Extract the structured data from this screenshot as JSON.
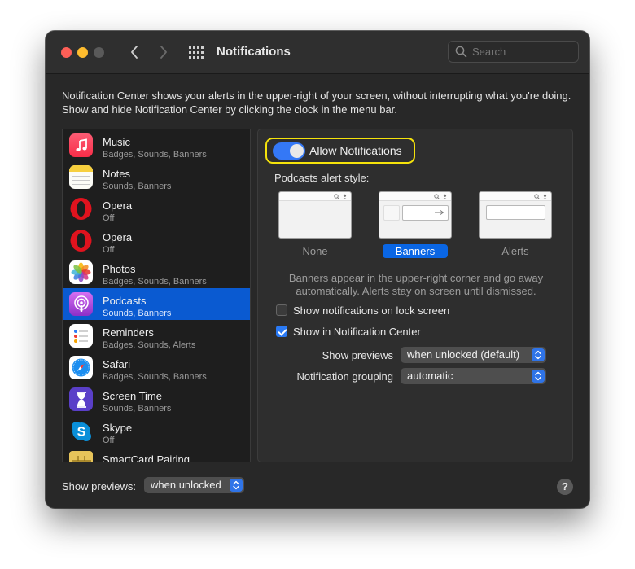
{
  "window": {
    "title": "Notifications"
  },
  "search": {
    "placeholder": "Search"
  },
  "description": "Notification Center shows your alerts in the upper-right of your screen, without interrupting what you're doing. Show and hide Notification Center by clicking the clock in the menu bar.",
  "apps": [
    {
      "name": "Music",
      "detail": "Badges, Sounds, Banners",
      "icon": "music-icon",
      "selected": false
    },
    {
      "name": "Notes",
      "detail": "Sounds, Banners",
      "icon": "notes-icon",
      "selected": false
    },
    {
      "name": "Opera",
      "detail": "Off",
      "icon": "opera-icon",
      "selected": false
    },
    {
      "name": "Opera",
      "detail": "Off",
      "icon": "opera-icon",
      "selected": false
    },
    {
      "name": "Photos",
      "detail": "Badges, Sounds, Banners",
      "icon": "photos-icon",
      "selected": false
    },
    {
      "name": "Podcasts",
      "detail": "Sounds, Banners",
      "icon": "podcasts-icon",
      "selected": true
    },
    {
      "name": "Reminders",
      "detail": "Badges, Sounds, Alerts",
      "icon": "reminders-icon",
      "selected": false
    },
    {
      "name": "Safari",
      "detail": "Badges, Sounds, Banners",
      "icon": "safari-icon",
      "selected": false
    },
    {
      "name": "Screen Time",
      "detail": "Sounds, Banners",
      "icon": "screen-time-icon",
      "selected": false
    },
    {
      "name": "Skype",
      "detail": "Off",
      "icon": "skype-icon",
      "selected": false
    },
    {
      "name": "SmartCard Pairing",
      "detail": "",
      "icon": "smartcard-icon",
      "selected": false
    }
  ],
  "detail": {
    "allow_label": "Allow Notifications",
    "allow_enabled": true,
    "alert_style_heading": "Podcasts alert style:",
    "alert_styles": [
      {
        "label": "None",
        "active": false
      },
      {
        "label": "Banners",
        "active": true
      },
      {
        "label": "Alerts",
        "active": false
      }
    ],
    "style_caption": "Banners appear in the upper-right corner and go away automatically. Alerts stay on screen until dismissed.",
    "lock_screen_label": "Show notifications on lock screen",
    "lock_screen_checked": false,
    "notification_center_label": "Show in Notification Center",
    "notification_center_checked": true,
    "show_previews_label": "Show previews",
    "show_previews_value": "when unlocked (default)",
    "grouping_label": "Notification grouping",
    "grouping_value": "automatic"
  },
  "footer": {
    "show_previews_label": "Show previews:",
    "show_previews_value": "when unlocked",
    "help_label": "?"
  },
  "colors": {
    "accent": "#0a5ad1",
    "highlight_outline": "#f5e30b",
    "close": "#fe5f57",
    "minimize": "#febc2e"
  }
}
